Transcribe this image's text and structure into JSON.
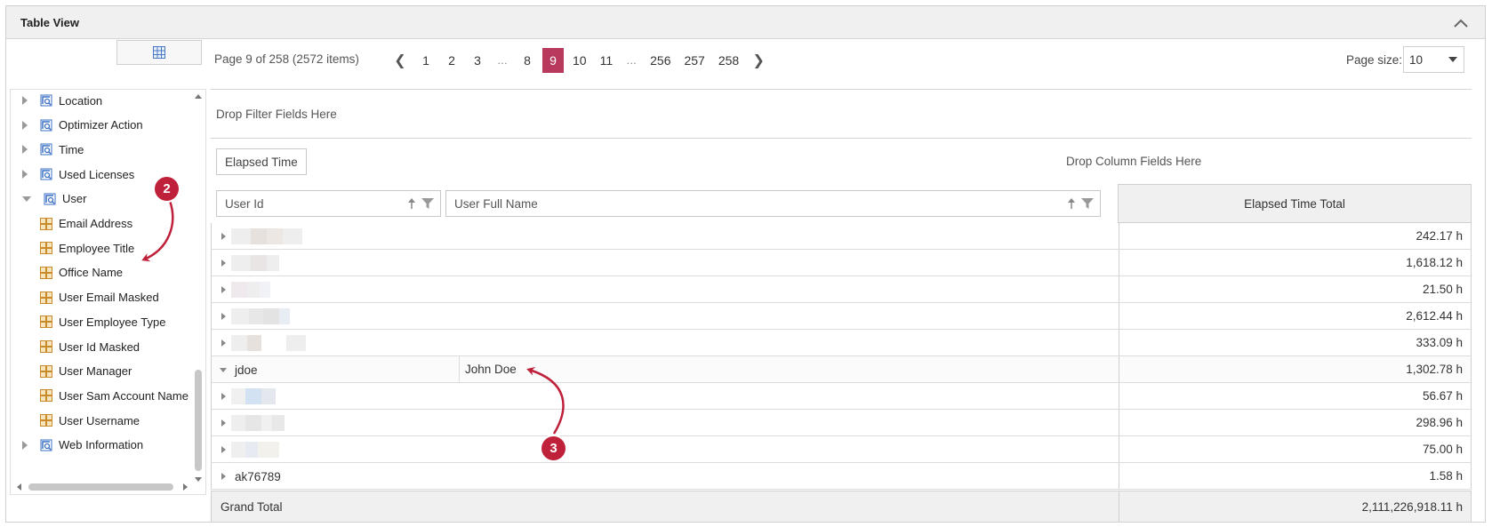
{
  "panel": {
    "title": "Table View"
  },
  "pager": {
    "info": "Page 9 of 258 (2572 items)",
    "prev_icon": "chevron-left-icon",
    "next_icon": "chevron-right-icon",
    "pages": [
      "1",
      "2",
      "3",
      "…",
      "8",
      "9",
      "10",
      "11",
      "…",
      "256",
      "257",
      "258"
    ],
    "current_page": "9",
    "page_size_label": "Page size:",
    "page_size_value": "10"
  },
  "tree": {
    "items": [
      {
        "label": "Location",
        "kind": "dimension",
        "expander": "closed"
      },
      {
        "label": "Optimizer Action",
        "kind": "dimension",
        "expander": "closed"
      },
      {
        "label": "Time",
        "kind": "dimension",
        "expander": "closed"
      },
      {
        "label": "Used Licenses",
        "kind": "dimension",
        "expander": "closed"
      },
      {
        "label": "User",
        "kind": "dimension",
        "expander": "open"
      },
      {
        "label": "Email Address",
        "kind": "attribute",
        "expander": "none"
      },
      {
        "label": "Employee Title",
        "kind": "attribute",
        "expander": "none"
      },
      {
        "label": "Office Name",
        "kind": "attribute",
        "expander": "none"
      },
      {
        "label": "User Email Masked",
        "kind": "attribute",
        "expander": "none"
      },
      {
        "label": "User Employee Type",
        "kind": "attribute",
        "expander": "none"
      },
      {
        "label": "User Id Masked",
        "kind": "attribute",
        "expander": "none"
      },
      {
        "label": "User Manager",
        "kind": "attribute",
        "expander": "none"
      },
      {
        "label": "User Sam Account Name",
        "kind": "attribute",
        "expander": "none"
      },
      {
        "label": "User Username",
        "kind": "attribute",
        "expander": "none"
      },
      {
        "label": "Web Information",
        "kind": "dimension",
        "expander": "closed"
      }
    ]
  },
  "grid": {
    "filter_drop_text": "Drop Filter Fields Here",
    "data_field_chip": "Elapsed Time",
    "column_drop_text": "Drop Column Fields Here",
    "row_fields": [
      "User Id",
      "User Full Name"
    ],
    "data_header": "Elapsed Time Total",
    "rows": [
      {
        "user_id": "",
        "full_name": "",
        "value": "242.17 h",
        "expanded": false,
        "redacted": true
      },
      {
        "user_id": "",
        "full_name": "",
        "value": "1,618.12 h",
        "expanded": false,
        "redacted": true
      },
      {
        "user_id": "",
        "full_name": "",
        "value": "21.50 h",
        "expanded": false,
        "redacted": true
      },
      {
        "user_id": "",
        "full_name": "",
        "value": "2,612.44 h",
        "expanded": false,
        "redacted": true
      },
      {
        "user_id": "",
        "full_name": "",
        "value": "333.09 h",
        "expanded": false,
        "redacted": true
      },
      {
        "user_id": "jdoe",
        "full_name": "John Doe",
        "value": "1,302.78 h",
        "expanded": true,
        "redacted": false
      },
      {
        "user_id": "",
        "full_name": "",
        "value": "56.67 h",
        "expanded": false,
        "redacted": true
      },
      {
        "user_id": "",
        "full_name": "",
        "value": "298.96 h",
        "expanded": false,
        "redacted": true
      },
      {
        "user_id": "",
        "full_name": "",
        "value": "75.00 h",
        "expanded": false,
        "redacted": true
      },
      {
        "user_id": "ak76789",
        "full_name": "",
        "value": "1.58 h",
        "expanded": false,
        "redacted": false
      }
    ],
    "grand_total_label": "Grand Total",
    "grand_total_value": "2,111,226,918.11 h"
  },
  "callouts": [
    "2",
    "3"
  ],
  "colors": {
    "accent": "#b8395b",
    "callout": "#c0213a",
    "header_bg": "#f0f0f0",
    "border": "#d0d0d0"
  }
}
